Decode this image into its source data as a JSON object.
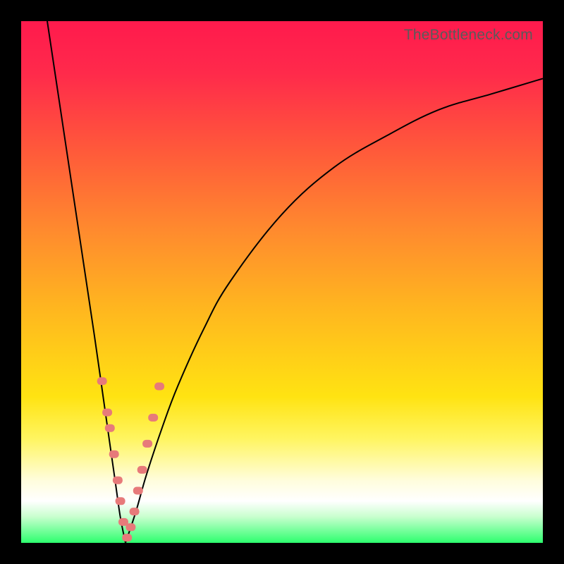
{
  "watermark": "TheBottleneck.com",
  "colors": {
    "frame_bg_top": "#ff1a4d",
    "frame_bg_bottom": "#2dff6e",
    "curve": "#000000",
    "marker": "#e77a7a",
    "page_bg": "#000000",
    "watermark_text": "#5a5a5a"
  },
  "chart_data": {
    "type": "line",
    "title": "",
    "xlabel": "",
    "ylabel": "",
    "xlim": [
      0,
      100
    ],
    "ylim": [
      0,
      100
    ],
    "grid": false,
    "legend": false,
    "note": "V-shaped bottleneck/mismatch curve. x is a normalized hardware capability axis; y is mismatch percentage. Minimum at x≈20.",
    "series": [
      {
        "name": "left-branch",
        "x": [
          5,
          8,
          11,
          14,
          16,
          18,
          19,
          20
        ],
        "values": [
          100,
          80,
          60,
          40,
          26,
          12,
          5,
          0
        ]
      },
      {
        "name": "right-branch",
        "x": [
          20,
          22,
          24,
          27,
          30,
          35,
          40,
          50,
          60,
          70,
          80,
          90,
          100
        ],
        "values": [
          0,
          6,
          13,
          22,
          30,
          41,
          50,
          63,
          72,
          78,
          83,
          86,
          89
        ]
      }
    ],
    "markers": {
      "name": "sample-points",
      "x": [
        15.5,
        16.5,
        17.0,
        17.8,
        18.5,
        19.0,
        19.6,
        20.3,
        21.0,
        21.7,
        22.4,
        23.2,
        24.2,
        25.3,
        26.5
      ],
      "values": [
        31,
        25,
        22,
        17,
        12,
        8,
        4,
        1,
        3,
        6,
        10,
        14,
        19,
        24,
        30
      ]
    }
  }
}
